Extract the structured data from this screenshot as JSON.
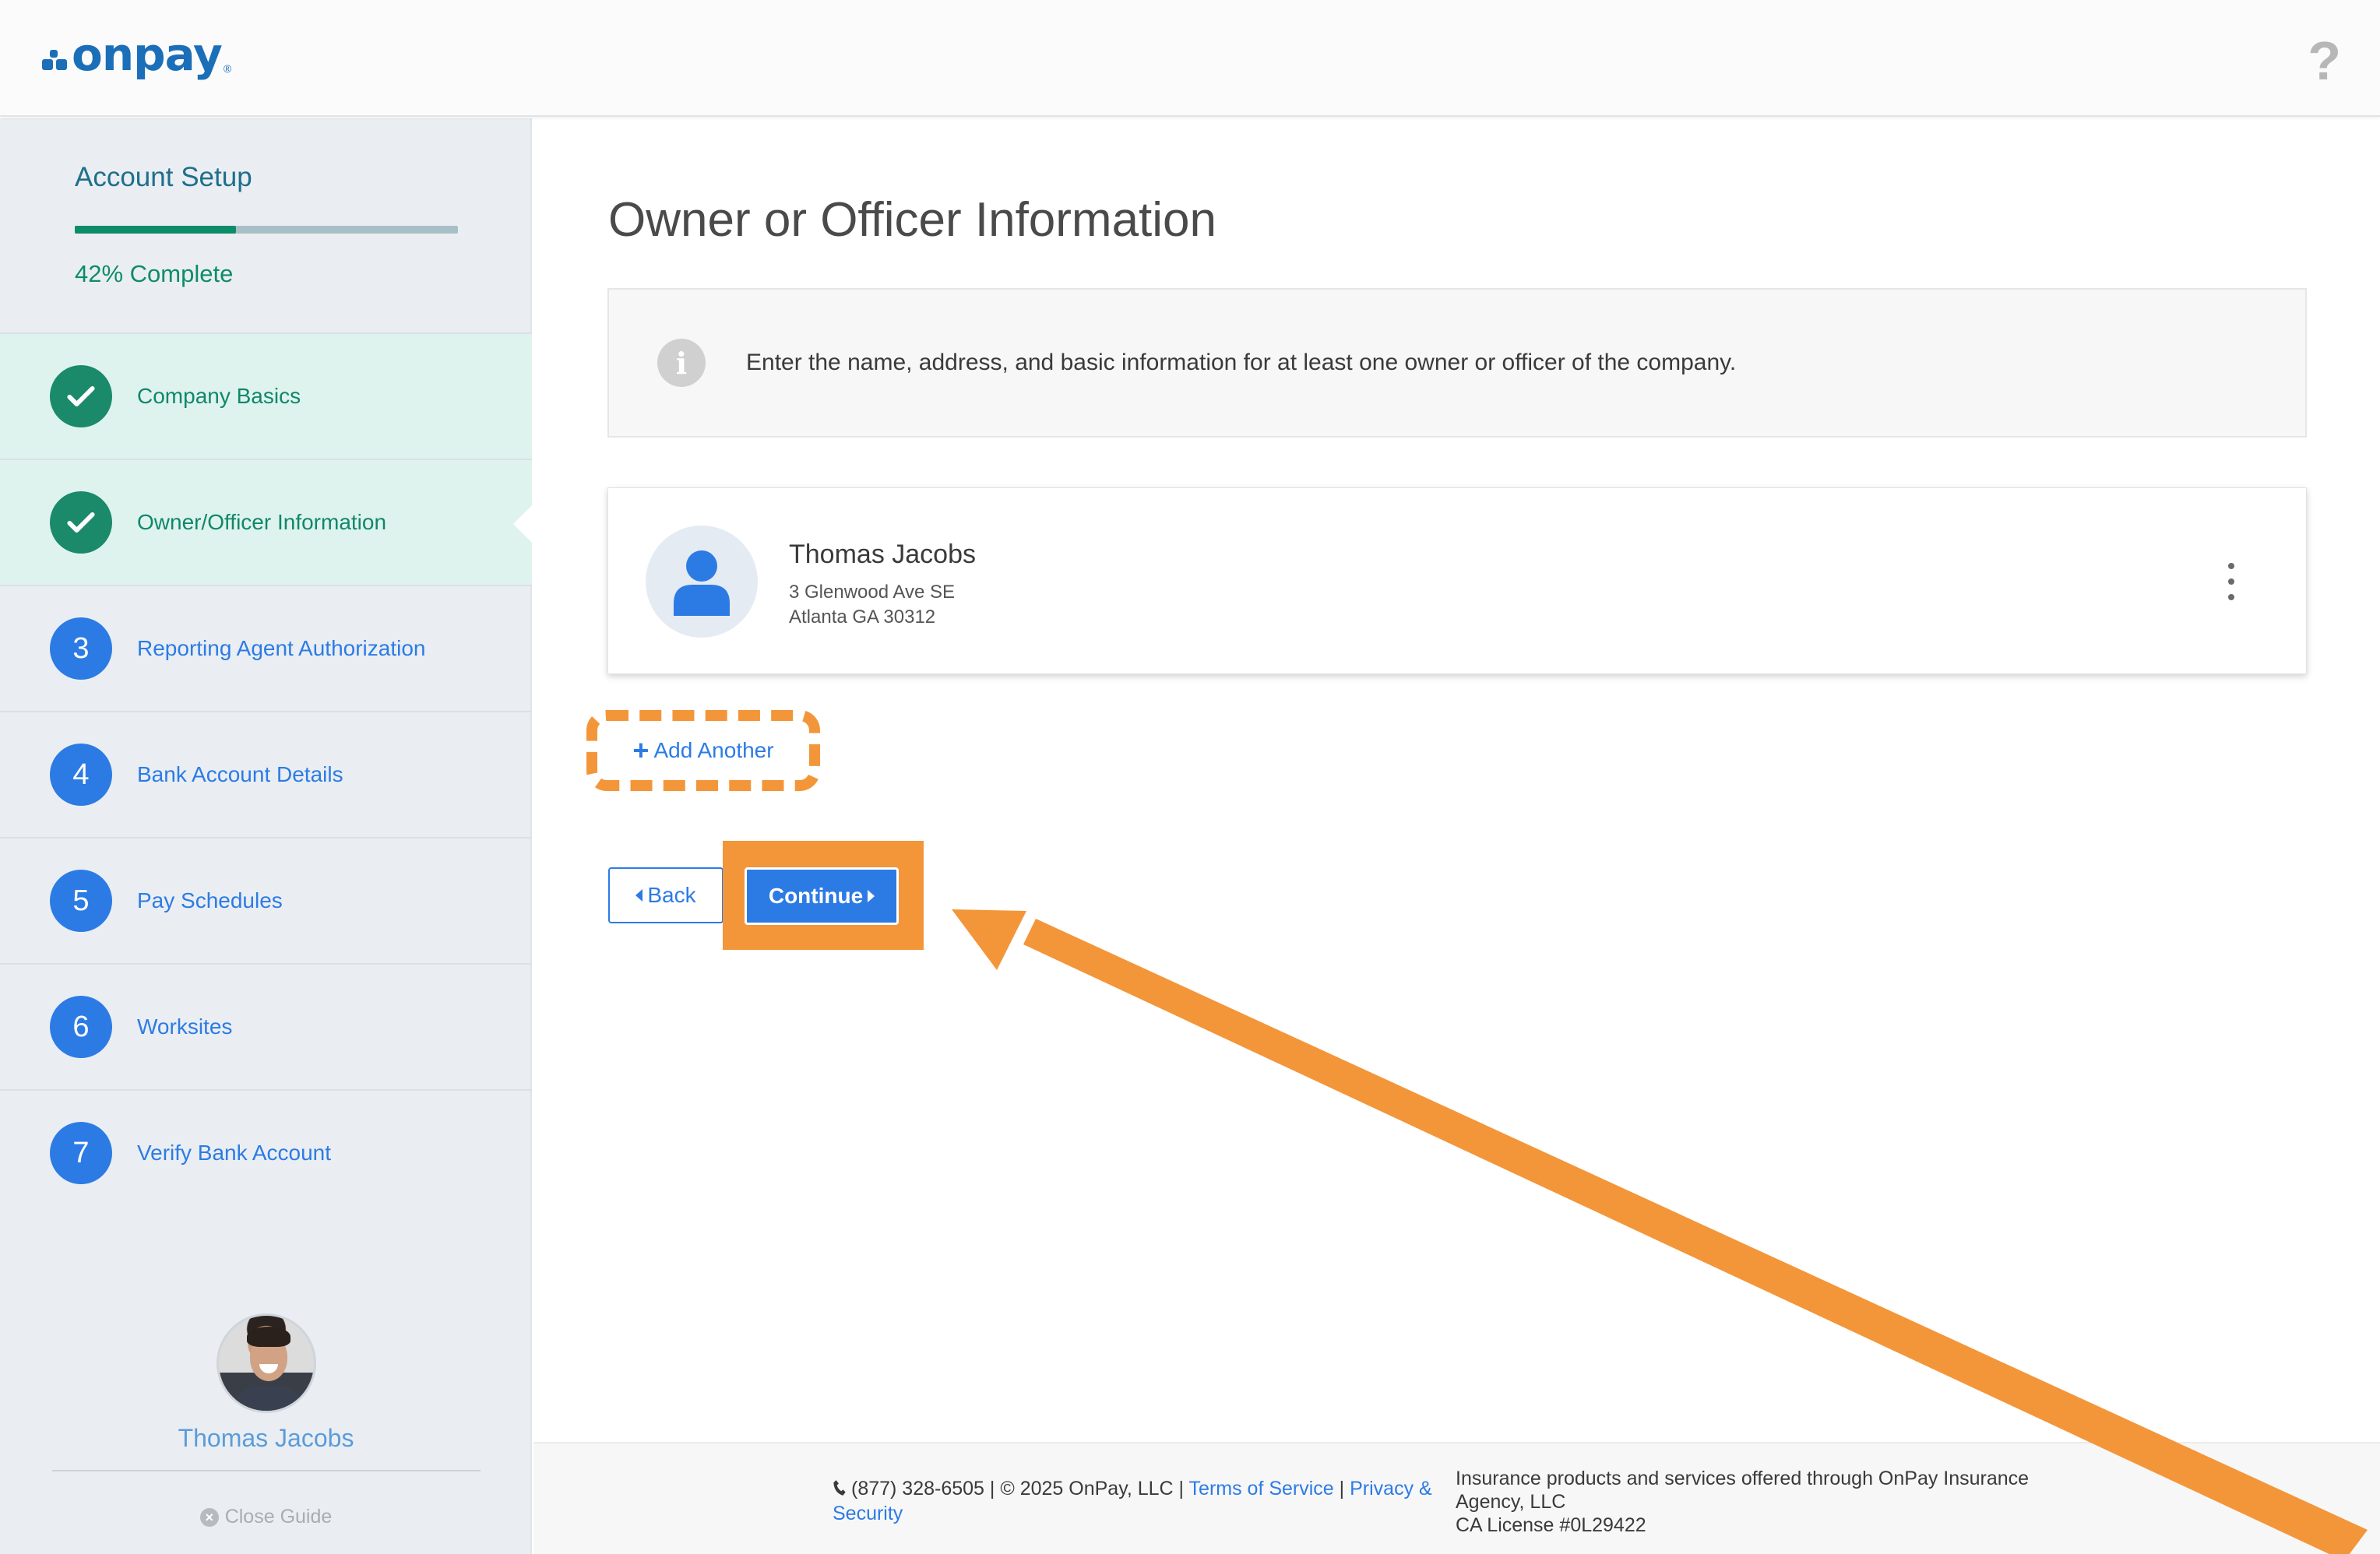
{
  "header": {
    "logo_text": "onpay",
    "logo_reg": "®",
    "help_icon": "?"
  },
  "sidebar": {
    "title": "Account Setup",
    "progress_fraction": 0.42,
    "progress_text": "42% Complete",
    "steps": [
      {
        "label": "Company Basics",
        "badge": "",
        "status": "done"
      },
      {
        "label": "Owner/Officer Information",
        "badge": "",
        "status": "done-active"
      },
      {
        "label": "Reporting Agent Authorization",
        "badge": "3",
        "status": "pending"
      },
      {
        "label": "Bank Account Details",
        "badge": "4",
        "status": "pending"
      },
      {
        "label": "Pay Schedules",
        "badge": "5",
        "status": "pending"
      },
      {
        "label": "Worksites",
        "badge": "6",
        "status": "pending"
      },
      {
        "label": "Verify Bank Account",
        "badge": "7",
        "status": "pending"
      }
    ],
    "profile_name": "Thomas Jacobs",
    "close_guide": "Close Guide"
  },
  "main": {
    "title": "Owner or Officer Information",
    "info_icon": "i",
    "info_text": "Enter the name, address, and basic information for at least one owner or officer of the company.",
    "person": {
      "name": "Thomas Jacobs",
      "address_line1": "3 Glenwood Ave SE",
      "address_line2": "Atlanta GA 30312"
    },
    "add_another_label": "Add Another",
    "back_label": "Back",
    "continue_label": "Continue"
  },
  "footer": {
    "phone": "(877) 328-6505",
    "copyright": " | © 2025 OnPay, LLC | ",
    "terms": "Terms of Service",
    "separator": " | ",
    "privacy": "Privacy & Security",
    "insurance_line1": "Insurance products and services offered through OnPay Insurance",
    "insurance_line2": "Agency, LLC",
    "license": "CA License #0L29422"
  },
  "annotation_color": "#f39639",
  "accent_color": "#2c7be5",
  "success_color": "#0e8c6a"
}
